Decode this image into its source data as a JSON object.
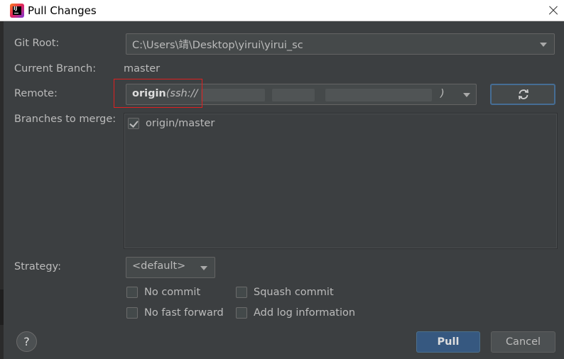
{
  "window": {
    "title": "Pull Changes"
  },
  "form": {
    "git_root_label": "Git Root:",
    "git_root_value": "C:\\Users\\靖\\Desktop\\yirui\\yirui_sc",
    "current_branch_label": "Current Branch:",
    "current_branch_value": "master",
    "remote_label": "Remote:",
    "remote_name": "origin",
    "remote_url_prefix": "(ssh://",
    "remote_url_suffix": ")",
    "branches_label": "Branches to merge:",
    "branches": [
      {
        "label": "origin/master",
        "checked": true
      }
    ],
    "strategy_label": "Strategy:",
    "strategy_value": "<default>"
  },
  "options": {
    "no_commit": "No commit",
    "squash_commit": "Squash commit",
    "no_fast_forward": "No fast forward",
    "add_log_information": "Add log information"
  },
  "buttons": {
    "help": "?",
    "pull": "Pull",
    "cancel": "Cancel"
  },
  "colors": {
    "background": "#3c3f41",
    "primary_button": "#365880",
    "highlight_box": "#e02020"
  }
}
